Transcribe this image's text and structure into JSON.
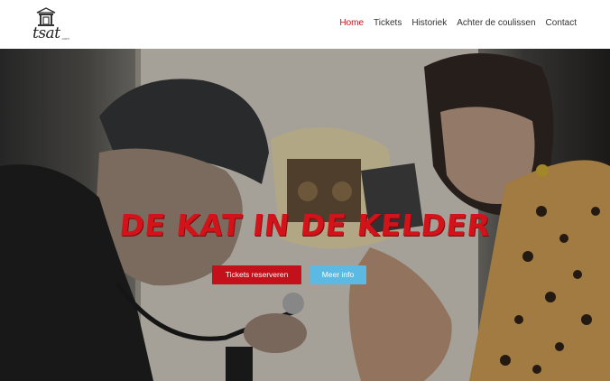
{
  "header": {
    "logo_text": "tsat",
    "logo_sub": ".com",
    "nav": [
      "Home",
      "Tickets",
      "Historiek",
      "Achter de coulissen",
      "Contact"
    ],
    "active_index": 0,
    "accent_color": "#c8161d"
  },
  "hero": {
    "title": "DE KAT IN DE KELDER",
    "buttons": {
      "tickets_label": "Tickets reserveren",
      "info_label": "Meer info"
    },
    "colors": {
      "tickets_button": "#c3101b",
      "info_button": "#5bb9e2",
      "title": "#d3131a"
    }
  }
}
